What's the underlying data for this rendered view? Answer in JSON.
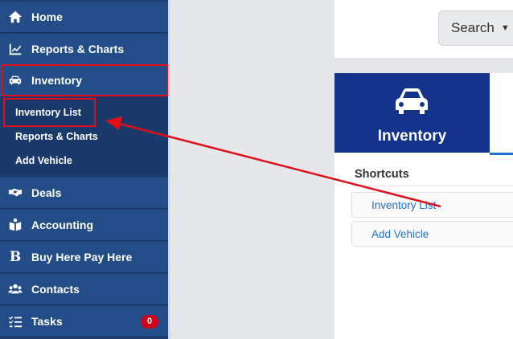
{
  "sidebar": {
    "items": [
      {
        "label": "Home",
        "icon": "home-icon"
      },
      {
        "label": "Reports & Charts",
        "icon": "line-chart-icon"
      },
      {
        "label": "Inventory",
        "icon": "car-icon"
      },
      {
        "label": "Deals",
        "icon": "handshake-icon"
      },
      {
        "label": "Accounting",
        "icon": "book-icon"
      },
      {
        "label": "Buy Here Pay Here",
        "icon": "b-icon"
      },
      {
        "label": "Contacts",
        "icon": "users-icon"
      },
      {
        "label": "Tasks",
        "icon": "tasks-icon",
        "badge": "0"
      }
    ],
    "inventory_sub": [
      "Inventory List",
      "Reports & Charts",
      "Add Vehicle"
    ]
  },
  "header": {
    "search_label": "Search"
  },
  "tile": {
    "title": "Inventory",
    "icon": "car-icon"
  },
  "shortcuts": {
    "heading": "Shortcuts",
    "items": [
      "Inventory List",
      "Add Vehicle"
    ]
  },
  "colors": {
    "sidebar": "#234d86",
    "tile": "#14338a",
    "link": "#1f6fd0",
    "highlight": "#e0101a",
    "badge": "#d0021b"
  }
}
